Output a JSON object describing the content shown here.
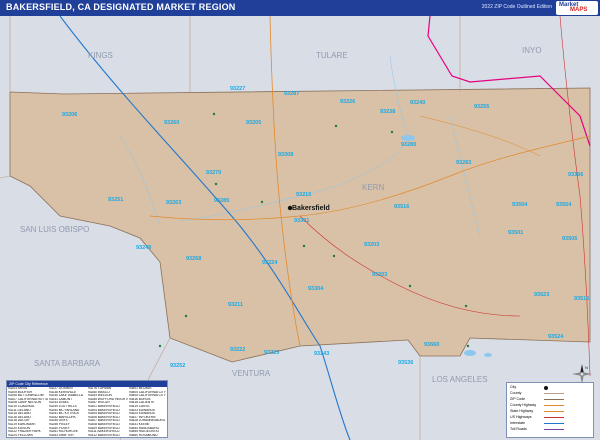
{
  "header": {
    "title": "BAKERSFIELD, CA DESIGNATED MARKET REGION",
    "edition": "2022 ZIP Code Outlined Edition",
    "logo_top": "Market",
    "logo_bottom": "MAPS"
  },
  "colors": {
    "header_bg": "#1f3f99",
    "outer_area": "#d9dde6",
    "region_fill": "#d8c1a6",
    "zip_label": "#18a9e6",
    "county_label": "#8f9bb0",
    "boundary": "#e6007e",
    "highway": "#2277cc",
    "water": "#8ec7ee"
  },
  "counties": [
    "KINGS",
    "TULARE",
    "INYO",
    "SAN LUIS OBISPO",
    "KERN",
    "SANTA BARBARA",
    "VENTURA",
    "LOS ANGELES"
  ],
  "city": "Bakersfield",
  "zip_codes": [
    "93227",
    "93287",
    "93226",
    "93240",
    "93255",
    "93238",
    "93206",
    "93260",
    "93205",
    "93283",
    "93308",
    "93280",
    "93270",
    "93215",
    "93306",
    "93516",
    "93504",
    "93301",
    "93285",
    "93263",
    "93251",
    "93554",
    "93249",
    "93268",
    "93501",
    "93505",
    "93224",
    "93304",
    "93523",
    "93516",
    "93211",
    "93203",
    "93203",
    "93560",
    "93524",
    "93222",
    "93225",
    "93243",
    "93536",
    "93252"
  ],
  "legend_table": {
    "heading": "ZIP Code City Reference",
    "columns": [
      [
        "93203 ARVIN",
        "93205 BODFISH",
        "93206 BUTTONWILLOW",
        "93207 CALIFORNIA HOT SPRINGS",
        "93208 CAMP NELSON",
        "93210 COALINGA",
        "93211 DELANO",
        "93215 DELANO",
        "93216 DELANO",
        "93218 DUCOR",
        "93219 EARLIMART",
        "93220 EDISON",
        "93222 FRAZIER PARK",
        "93224 FELLOWS",
        "93225 FRAZIER PARK",
        "93226 GLENNVILLE"
      ],
      [
        "93227 GOSHEN",
        "93238 KERNVILLE",
        "93240 LAKE ISABELLA",
        "93241 LAMONT",
        "93243 LEBEC",
        "93249 LOST HILLS",
        "93250 MC FARLAND",
        "93251 MC KITTRICK",
        "93252 MARICOPA",
        "93255 ONYX",
        "93256 PIXLEY",
        "93260 POSEY",
        "93261 RICHGROVE",
        "93263 SHAFTER",
        "93268 TAFT",
        "93270 TERRA BELLA"
      ],
      [
        "93276 TUPMAN",
        "93280 WASCO",
        "93283 WELDON",
        "93285 WOFFORD HEIGHTS",
        "93287 WOODY",
        "93301 BAKERSFIELD",
        "93304 BAKERSFIELD",
        "93305 BAKERSFIELD",
        "93306 BAKERSFIELD",
        "93307 BAKERSFIELD",
        "93308 BAKERSFIELD",
        "93309 BAKERSFIELD",
        "93311 BAKERSFIELD",
        "93312 BAKERSFIELD",
        "93313 BAKERSFIELD",
        "93314 BAKERSFIELD"
      ],
      [
        "93501 MOJAVE",
        "93504 CALIFORNIA CITY",
        "93505 CALIFORNIA CITY",
        "93516 BORON",
        "93518 CALIENTE",
        "93519 CANTIL",
        "93523 EDWARDS",
        "93524 EDWARDS",
        "93527 INYOKERN",
        "93528 JOHANNESBURG",
        "93531 KEENE",
        "93554 RANDSBURG",
        "93555 RIDGECREST",
        "93560 ROSAMOND",
        "93561 TEHACHAPI",
        "93596 BORON"
      ]
    ]
  },
  "key": {
    "items": [
      "City",
      "County",
      "ZIP Code",
      "County Highway",
      "State Highway",
      "US Highways",
      "Interstate",
      "Toll Roads"
    ]
  },
  "compass": {
    "letter": "N"
  }
}
